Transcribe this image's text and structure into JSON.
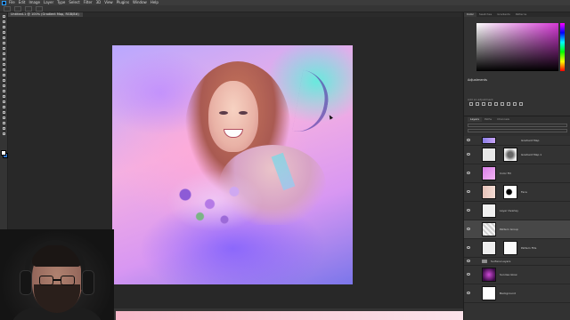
{
  "menubar": {
    "items": [
      "File",
      "Edit",
      "Image",
      "Layer",
      "Type",
      "Select",
      "Filter",
      "3D",
      "View",
      "Plugins",
      "Window",
      "Help"
    ]
  },
  "document_tab": {
    "title": "Untitled-1 @ 100% (Gradient Map, RGB/8#)"
  },
  "right_panel": {
    "color_tabs": [
      "Color",
      "Swatches",
      "Gradients",
      "Patterns"
    ],
    "adjustments_title": "Adjustments",
    "adjustments_subtitle": "Add an adjustment",
    "layers_tabs": [
      "Layers",
      "Paths",
      "Channels"
    ]
  },
  "layers": [
    {
      "name": "Gradient Map"
    },
    {
      "name": "Gradient Map 1"
    },
    {
      "name": "Color Fill"
    },
    {
      "name": "Face"
    },
    {
      "name": "Layer Overlay"
    },
    {
      "name": "Pattern Group",
      "selected": true
    },
    {
      "name": "Pattern Fills"
    },
    {
      "name": "Surface Layers"
    },
    {
      "name": "Sunrise Glow"
    },
    {
      "name": "Background"
    }
  ],
  "colors": {
    "accent": "#2fa3ff",
    "foreground": "#ffffff",
    "background": "#2e74c9"
  }
}
